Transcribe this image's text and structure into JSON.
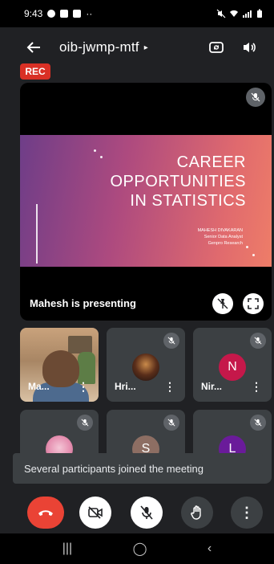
{
  "status_bar": {
    "time": "9:43",
    "dots": "··"
  },
  "app_bar": {
    "back_icon": "arrow-back-icon",
    "meeting_code": "oib-jwmp-mtf",
    "meeting_arrow": "▸"
  },
  "rec_badge": "REC",
  "stage": {
    "slide": {
      "title_lines": [
        "CAREER",
        "OPPORTUNITIES",
        "IN STATISTICS"
      ],
      "author": "MAHESH DIVAKARAN",
      "role": "Senior Data Analyst",
      "company": "Genpro Research"
    },
    "presenting_text": "Mahesh is presenting"
  },
  "participants": [
    {
      "name": "Ma...",
      "type": "video"
    },
    {
      "name": "Hri...",
      "type": "photo"
    },
    {
      "name": "Nir...",
      "type": "initial",
      "initial": "N",
      "color": "#c5184a"
    },
    {
      "name": "",
      "type": "photo"
    },
    {
      "name": "",
      "type": "initial",
      "initial": "S",
      "color": "#8d6e63"
    },
    {
      "name": "",
      "type": "initial",
      "initial": "L",
      "color": "#6a1b9a"
    }
  ],
  "toast": "Several participants joined the meeting",
  "colors": {
    "end_call": "#ea4335",
    "rec": "#d93025",
    "background": "#202124"
  },
  "nav": {
    "recents": "|||",
    "home": "◯",
    "back": "‹"
  }
}
